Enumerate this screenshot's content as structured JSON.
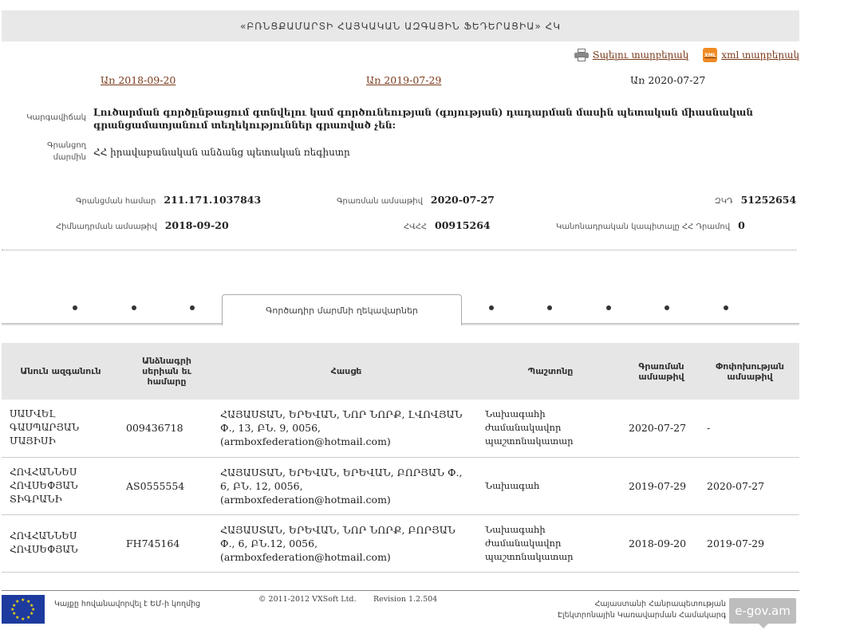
{
  "header": {
    "title": "«ԲՌՆՑՔԱՄԱՐՏԻ ՀԱՅԿԱԿԱՆ ԱԶԳԱՅԻՆ ՖԵԴԵՐԱՑԻԱ» ՀԿ"
  },
  "export": {
    "print_label": "Տպելու տարբերակ",
    "print_icon": "printer-icon",
    "xml_label": "xml տարբերակ",
    "xml_icon_text": "XML"
  },
  "dates": {
    "link1": "Առ 2018-09-20",
    "link2": "Առ 2019-07-29",
    "current": "Առ 2020-07-27"
  },
  "info": {
    "status_label": "Կարգավիճակ",
    "status_value": "Լուծարման գործընթացում գտնվելու կամ գործունեության (գոյության) դադարման մասին պետական միասնական գրանցամատյանում տեղեկություններ գրառված չեն:",
    "registrar_label": "Գրանցող մարմին",
    "registrar_value": "ՀՀ իրավաբանական անձանց պետական ռեգիստր"
  },
  "fields": {
    "reg_num_label": "Գրանցման համար",
    "reg_num_value": "211.171.1037843",
    "reg_date_label": "Գրառման ամսաթիվ",
    "reg_date_value": "2020-07-27",
    "tin_label": "ՀՎՀՀ",
    "tin_value": "00915264",
    "ipn_label": "ԶԿԴ",
    "ipn_value": "51252654",
    "found_date_label": "Հիմնադրման ամսաթիվ",
    "found_date_value": "2018-09-20",
    "capital_label": "Կանոնադրական կապիտալը ՀՀ Դրամով",
    "capital_value": "0"
  },
  "tabs": {
    "active_label": "Գործադիր մարմնի ղեկավարներ"
  },
  "table": {
    "headers": [
      "Անուն ազգանուն",
      "Անձնագրի սերիան եւ համարը",
      "Հասցե",
      "Պաշտոնը",
      "Գրառման ամսաթիվ",
      "Փոփոխության ամսաթիվ"
    ],
    "rows": [
      [
        "ՍԱՄՎԵԼ ԳԱՍՊԱՐՅԱՆ ՄԱՅԻՍԻ",
        "009436718",
        "ՀԱՅԱՍՏԱՆ, ԵՐԵՎԱՆ, ՆՈՐ ՆՈՐՔ, ԼՎՈՎՅԱՆ Փ., 13, ԲՆ. 9, 0056, (armboxfederation@hotmail.com)",
        "Նախագահի ժամանակավոր պաշտոնակատար",
        "2020-07-27",
        "-"
      ],
      [
        "ՀՈՎՀԱՆՆԵՍ ՀՈՎՍԵՓՅԱՆ ՏԻԳՐԱՆԻ",
        "AS0555554",
        "ՀԱՅԱՍՏԱՆ, ԵՐԵՎԱՆ, ԵՐԵՎԱՆ, ԲՈՐՅԱՆ Փ., 6, ԲՆ. 12, 0056, (armboxfederation@hotmail.com)",
        "Նախագահ",
        "2019-07-29",
        "2020-07-27"
      ],
      [
        "ՀՈՎՀԱՆՆԵՍ ՀՈՎՍԵՓՅԱՆ",
        "FH745164",
        "ՀԱՅԱՍՏԱՆ, ԵՐԵՎԱՆ, ՆՈՐ ՆՈՐՔ, ԲՈՐՅԱՆ Փ., 6, ԲՆ.12, 0056, (armboxfederation@hotmail.com)",
        "Նախագահի ժամանակավոր պաշտոնակատար",
        "2018-09-20",
        "2019-07-29"
      ]
    ]
  },
  "footer": {
    "eu_text": "Կայքը հովանավորվել է ԵՄ-ի կողմից",
    "copyright": "© 2011-2012 VXSoft Ltd.",
    "revision": "Revision 1.2.504",
    "gov_line1": "Հայաստանի Հանրապետության",
    "gov_line2": "Էլեկտրոնային Կառավարման Համակարգ",
    "egov_badge": "e-gov.am"
  },
  "colors": {
    "link": "#7a3a1a",
    "header_bg": "#e8e8e8",
    "eu_blue": "#1d3a9e",
    "xml_orange": "#f08a24"
  }
}
